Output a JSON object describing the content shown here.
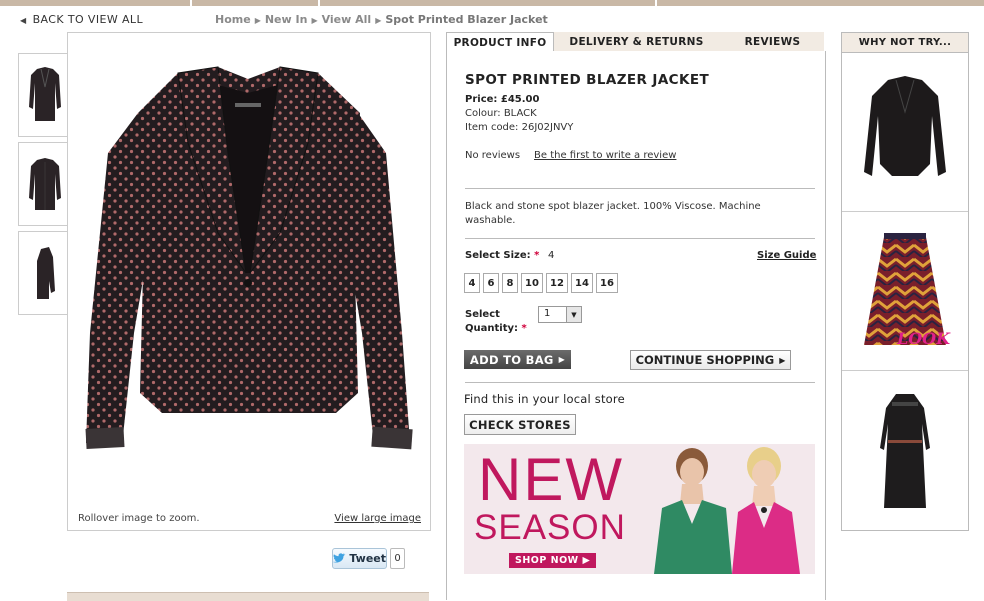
{
  "nav": {
    "back_label": "BACK TO VIEW ALL",
    "breadcrumb": [
      "Home",
      "New In",
      "View All",
      "Spot Printed Blazer Jacket"
    ]
  },
  "gallery": {
    "zoom_hint": "Rollover image to zoom.",
    "large_image_link": "View large image",
    "thumbnails": [
      "front",
      "back",
      "side"
    ]
  },
  "social": {
    "tweet_label": "Tweet",
    "tweet_count": "0"
  },
  "tabs": [
    "PRODUCT INFO",
    "DELIVERY & RETURNS",
    "REVIEWS"
  ],
  "active_tab": "PRODUCT INFO",
  "product": {
    "title": "SPOT PRINTED BLAZER JACKET",
    "price": "Price: £45.00",
    "colour": "Colour: BLACK",
    "item_code": "Item code: 26J02JNVY",
    "no_reviews": "No reviews",
    "write_review": "Be the first to write a review",
    "description": "Black and stone spot blazer jacket. 100% Viscose. Machine washable."
  },
  "size": {
    "label": "Select Size:",
    "required_mark": "*",
    "selected": "4",
    "guide_link": "Size Guide",
    "options": [
      "4",
      "6",
      "8",
      "10",
      "12",
      "14",
      "16"
    ]
  },
  "quantity": {
    "label_line1": "Select",
    "label_line2": "Quantity:",
    "required_mark": "*",
    "value": "1"
  },
  "actions": {
    "add_to_bag": "ADD TO BAG",
    "continue_shopping": "CONTINUE SHOPPING",
    "find_store": "Find this in your local store",
    "check_stores": "CHECK STORES"
  },
  "banner": {
    "line1": "NEW",
    "line2": "SEASON",
    "cta": "SHOP NOW"
  },
  "sidebar": {
    "title": "WHY NOT TRY...",
    "items": [
      "black fitted jacket",
      "chevron print skirt",
      "black lace dress"
    ],
    "badge": "LOOK"
  },
  "colors": {
    "accent": "#c0185e",
    "tab_bg": "#f2ebe3",
    "border": "#bbbbbb"
  }
}
